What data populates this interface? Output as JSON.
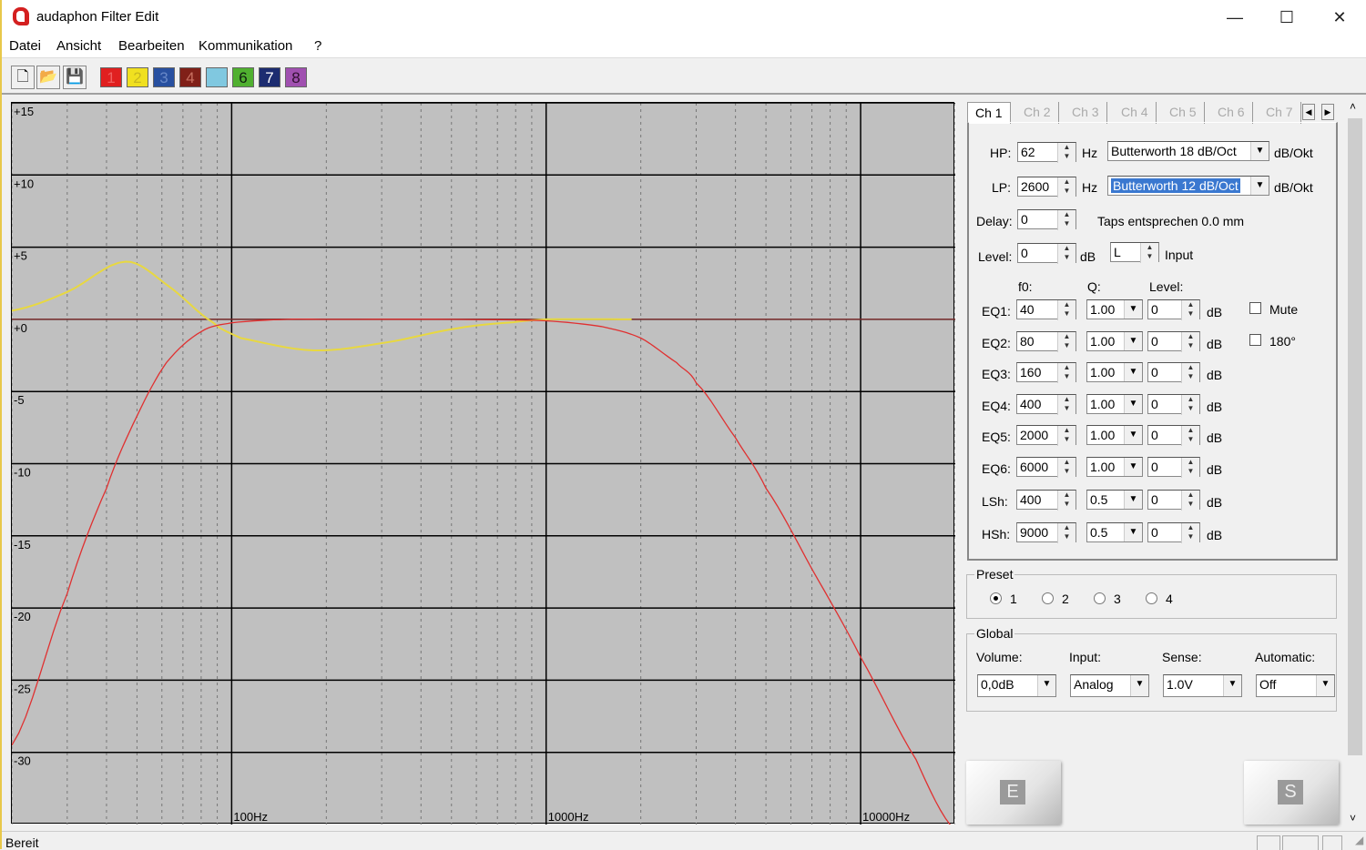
{
  "window": {
    "title": "audaphon Filter Edit",
    "minimize": "—",
    "maximize": "☐",
    "close": "✕"
  },
  "menu": [
    "Datei",
    "Ansicht",
    "Bearbeiten",
    "Kommunikation",
    "?"
  ],
  "toolbar": {
    "file_icons": [
      "new-file-icon",
      "open-folder-icon",
      "save-disk-icon"
    ],
    "channels": [
      {
        "label": "1",
        "bg": "#e02020",
        "fg": "#f06060"
      },
      {
        "label": "2",
        "bg": "#f0e020",
        "fg": "#c8b820"
      },
      {
        "label": "3",
        "bg": "#2850a0",
        "fg": "#6888c8"
      },
      {
        "label": "4",
        "bg": "#802018",
        "fg": "#c87060"
      },
      {
        "label": "",
        "bg": "#80c8e0",
        "fg": "#80c8e0"
      },
      {
        "label": "6",
        "bg": "#50b030",
        "fg": "#102010"
      },
      {
        "label": "7",
        "bg": "#1c2c70",
        "fg": "#ffffff"
      },
      {
        "label": "8",
        "bg": "#a050b0",
        "fg": "#301030"
      }
    ]
  },
  "chart_data": {
    "type": "line",
    "x_scale": "log",
    "xlim": [
      20,
      20000
    ],
    "ylim": [
      -35,
      15
    ],
    "y_ticks": [
      15,
      10,
      5,
      0,
      -5,
      -10,
      -15,
      -20,
      -25,
      -30
    ],
    "y_tick_labels": [
      "+15",
      "+10",
      "+5",
      "+0",
      "-5",
      "-10",
      "-15",
      "-20",
      "-25",
      "-30"
    ],
    "x_ticks": [
      100,
      1000,
      10000
    ],
    "x_tick_labels": [
      "100Hz",
      "1000Hz",
      "10000Hz"
    ],
    "grid": true,
    "background": "#c0c0c0",
    "series": [
      {
        "color": "#e03030",
        "x": [
          20,
          30,
          40,
          50,
          62,
          80,
          100,
          150,
          200,
          500,
          1000,
          1500,
          2000,
          2600,
          3000,
          4000,
          5000,
          7000,
          10000,
          15000,
          20000
        ],
        "y": [
          -29.5,
          -19,
          -11.7,
          -6.7,
          -3,
          -0.85,
          -0.24,
          0,
          0,
          0,
          -0.1,
          -0.5,
          -1.3,
          -3,
          -4.4,
          -8.2,
          -11.7,
          -17.3,
          -23.4,
          -30.5,
          -35.4
        ]
      },
      {
        "color": "#e8d840",
        "x": [
          20,
          30,
          46,
          63,
          87,
          107,
          182,
          310,
          530,
          786,
          1000,
          1870
        ],
        "y": [
          0.6,
          1.9,
          4.0,
          2.3,
          -0.2,
          -1.3,
          -2.15,
          -1.6,
          -0.6,
          -0.2,
          0,
          0
        ]
      }
    ],
    "reference_line": {
      "y": 0,
      "color": "#b04040"
    }
  },
  "tabs": [
    "Ch 1",
    "Ch 2",
    "Ch 3",
    "Ch 4",
    "Ch 5",
    "Ch 6",
    "Ch 7"
  ],
  "channel": {
    "hp": {
      "label": "HP:",
      "value": "62",
      "unit": "Hz",
      "type": "Butterworth 18 dB/Oct",
      "type_unit": "dB/Okt"
    },
    "lp": {
      "label": "LP:",
      "value": "2600",
      "unit": "Hz",
      "type": "Butterworth 12 dB/Oct",
      "type_unit": "dB/Okt"
    },
    "delay": {
      "label": "Delay:",
      "value": "0",
      "info": "Taps entsprechen 0.0 mm"
    },
    "level": {
      "label": "Level:",
      "value": "0",
      "unit": "dB",
      "input_value": "L",
      "input_label": "Input"
    },
    "eq_headers": {
      "f0": "f0:",
      "q": "Q:",
      "level": "Level:"
    },
    "eq": [
      {
        "label": "EQ1:",
        "f0": "40",
        "q": "1.00",
        "level": "0",
        "unit": "dB"
      },
      {
        "label": "EQ2:",
        "f0": "80",
        "q": "1.00",
        "level": "0",
        "unit": "dB"
      },
      {
        "label": "EQ3:",
        "f0": "160",
        "q": "1.00",
        "level": "0",
        "unit": "dB"
      },
      {
        "label": "EQ4:",
        "f0": "400",
        "q": "1.00",
        "level": "0",
        "unit": "dB"
      },
      {
        "label": "EQ5:",
        "f0": "2000",
        "q": "1.00",
        "level": "0",
        "unit": "dB"
      },
      {
        "label": "EQ6:",
        "f0": "6000",
        "q": "1.00",
        "level": "0",
        "unit": "dB"
      },
      {
        "label": "LSh:",
        "f0": "400",
        "q": "0.5",
        "level": "0",
        "unit": "dB"
      },
      {
        "label": "HSh:",
        "f0": "9000",
        "q": "0.5",
        "level": "0",
        "unit": "dB"
      }
    ],
    "mute": {
      "label": "Mute",
      "checked": false
    },
    "invert": {
      "label": "180°",
      "checked": false
    }
  },
  "preset": {
    "title": "Preset",
    "options": [
      "1",
      "2",
      "3",
      "4"
    ],
    "selected": "1"
  },
  "global": {
    "title": "Global",
    "volume": {
      "label": "Volume:",
      "value": "0,0dB"
    },
    "input": {
      "label": "Input:",
      "value": "Analog"
    },
    "sense": {
      "label": "Sense:",
      "value": "1.0V"
    },
    "automatic": {
      "label": "Automatic:",
      "value": "Off"
    }
  },
  "buttons": {
    "e": "E",
    "s": "S"
  },
  "status": "Bereit"
}
